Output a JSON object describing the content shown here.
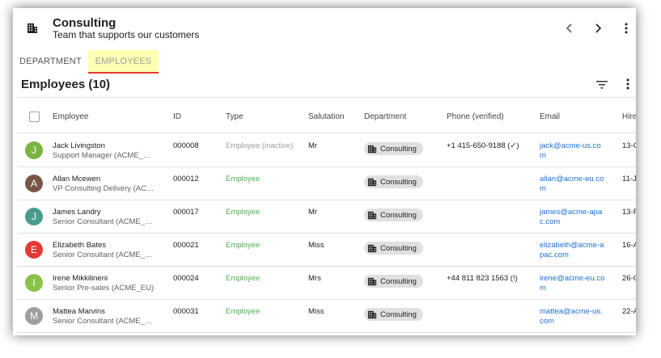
{
  "header": {
    "title": "Consulting",
    "subtitle": "Team that supports our customers",
    "icon": "building-icon"
  },
  "tabs": [
    {
      "label": "DEPARTMENT",
      "active": false
    },
    {
      "label": "EMPLOYEES",
      "active": true
    }
  ],
  "section": {
    "title": "Employees (10)"
  },
  "columns": [
    "Employee",
    "ID",
    "Type",
    "Salutation",
    "Department",
    "Phone (verified)",
    "Email",
    "Hire"
  ],
  "colors": {
    "employee_green": "#4caf50",
    "inactive_gray": "#9e9e9e",
    "email_blue": "#1e6fd0",
    "tab_highlight": "#ffffb3",
    "tab_underline": "#e53935"
  },
  "rows": [
    {
      "initial": "J",
      "avatar_color": "#7cb342",
      "name": "Jack Livingston",
      "role": "Support Manager (ACME_US)",
      "id": "000008",
      "type": "Employee (inactive)",
      "type_status": "inactive",
      "salutation": "Mr",
      "department": "Consulting",
      "phone": "+1 415-650-9188 (✓)",
      "email": "jack@acme-us.com",
      "hire": "13-C"
    },
    {
      "initial": "A",
      "avatar_color": "#795548",
      "name": "Allan Mcewen",
      "role": "VP Consulting Delivery (ACME_US)",
      "id": "000012",
      "type": "Employee",
      "type_status": "active",
      "salutation": "",
      "department": "Consulting",
      "phone": "",
      "email": "allan@acme-eu.com",
      "hire": "11-J"
    },
    {
      "initial": "J",
      "avatar_color": "#4a9b8e",
      "name": "James Landry",
      "role": "Senior Consultant (ACME_APAC)",
      "id": "000017",
      "type": "Employee",
      "type_status": "active",
      "salutation": "Mr",
      "department": "Consulting",
      "phone": "",
      "email": "james@acme-apac.com",
      "hire": "13-F"
    },
    {
      "initial": "E",
      "avatar_color": "#e53935",
      "name": "Elizabeth Bates",
      "role": "Senior Consultant (ACME_APAC)",
      "id": "000021",
      "type": "Employee",
      "type_status": "active",
      "salutation": "Miss",
      "department": "Consulting",
      "phone": "",
      "email": "elizabeth@acme-apac.com",
      "hire": "16-A"
    },
    {
      "initial": "I",
      "avatar_color": "#8bc34a",
      "name": "Irene Mikkilineni",
      "role": "Senior Pre-sales (ACME_EU)",
      "id": "000024",
      "type": "Employee",
      "type_status": "active",
      "salutation": "Mrs",
      "department": "Consulting",
      "phone": "+44 811 823 1563 (!)",
      "email": "irene@acme-eu.com",
      "hire": "26-C"
    },
    {
      "initial": "M",
      "avatar_color": "#9e9e9e",
      "name": "Mattea Marvins",
      "role": "Senior Consultant (ACME_US)",
      "id": "000031",
      "type": "Employee",
      "type_status": "active",
      "salutation": "Miss",
      "department": "Consulting",
      "phone": "",
      "email": "mattea@acme-us.com",
      "hire": "22-A"
    }
  ]
}
